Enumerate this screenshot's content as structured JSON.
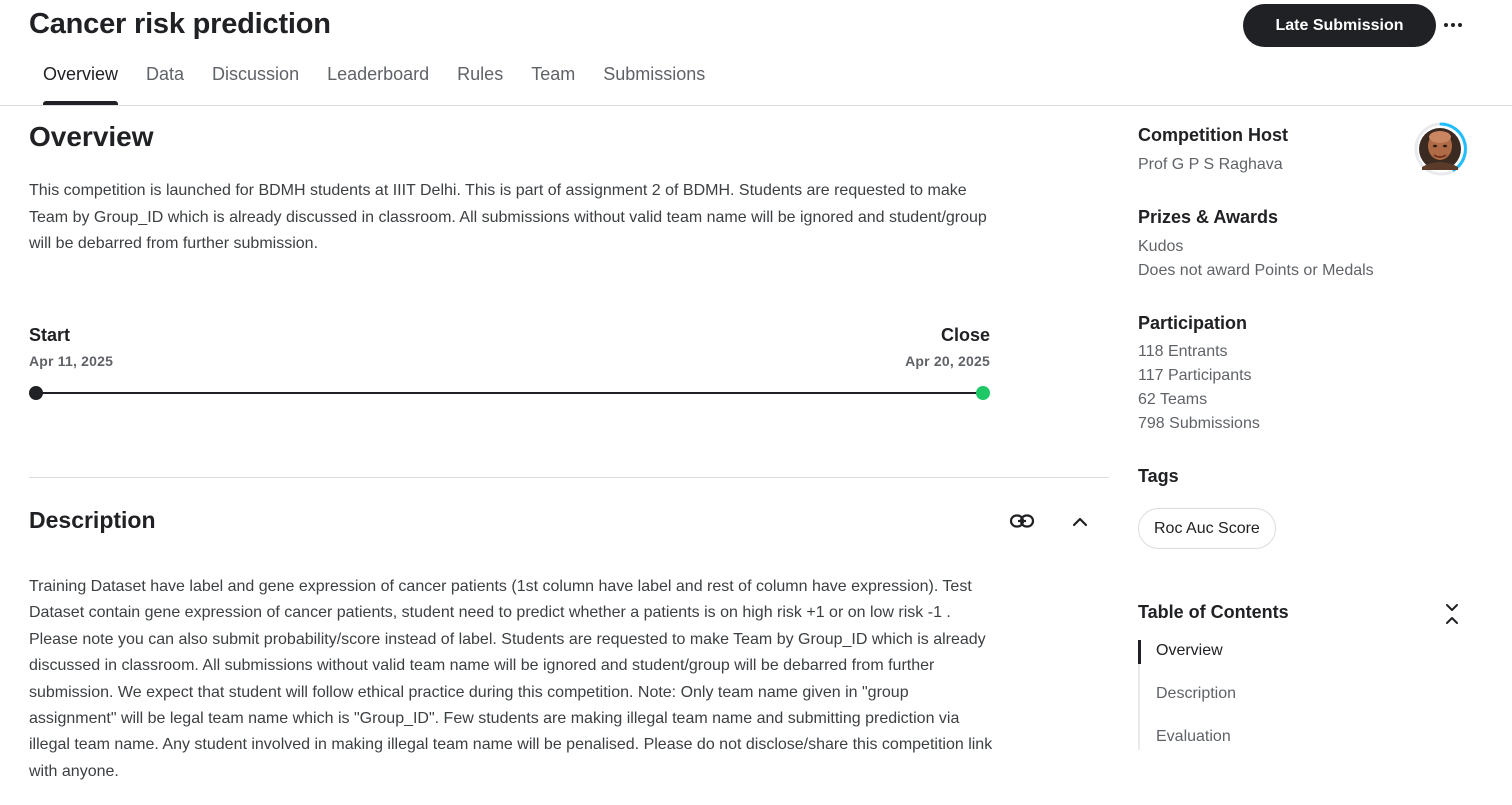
{
  "header": {
    "title": "Cancer risk prediction",
    "late_submission_label": "Late Submission",
    "more_label": "More options"
  },
  "tabs": [
    {
      "label": "Overview",
      "active": true
    },
    {
      "label": "Data"
    },
    {
      "label": "Discussion"
    },
    {
      "label": "Leaderboard"
    },
    {
      "label": "Rules"
    },
    {
      "label": "Team"
    },
    {
      "label": "Submissions"
    }
  ],
  "overview": {
    "title": "Overview",
    "text": "This competition is launched for BDMH students at IIIT Delhi. This is part of assignment 2 of BDMH. Students are requested to make Team by Group_ID which is already discussed in classroom. All submissions without valid team name will be ignored and student/group will be debarred from further submission."
  },
  "timeline": {
    "start_label": "Start",
    "start_date": "Apr 11, 2025",
    "close_label": "Close",
    "close_date": "Apr 20, 2025",
    "progress": 1.0,
    "end_color": "#1ec866"
  },
  "description": {
    "title": "Description",
    "link_icon": "link-icon",
    "collapse_icon": "chevron-up-icon",
    "text": "Training Dataset have label and gene expression of cancer patients (1st column have label and rest of column have expression). Test Dataset contain gene expression of cancer patients, student need to predict whether a patients is on high risk +1 or on low risk -1 . Please note you can also submit probability/score instead of label. Students are requested to make Team by Group_ID which is already discussed in classroom. All submissions without valid team name will be ignored and student/group will be debarred from further submission. We expect that student will follow ethical practice during this competition. Note: Only team name given in \"group assignment\" will be legal team name which is \"Group_ID\". Few students are making illegal team name and submitting prediction via illegal team name. Any student involved in making illegal team name will be penalised. Please do not disclose/share this competition link with anyone."
  },
  "sidebar": {
    "host_title": "Competition Host",
    "host_name": "Prof G P S Raghava",
    "prizes_title": "Prizes & Awards",
    "prizes": [
      "Kudos",
      "Does not award Points or Medals"
    ],
    "participation_title": "Participation",
    "participation": [
      "118 Entrants",
      "117 Participants",
      "62 Teams",
      "798 Submissions"
    ],
    "tags_title": "Tags",
    "tags": [
      "Roc Auc Score"
    ],
    "toc_title": "Table of Contents",
    "toc": [
      {
        "label": "Overview",
        "active": true
      },
      {
        "label": "Description"
      },
      {
        "label": "Evaluation"
      }
    ]
  },
  "colors": {
    "primary_text": "#202124",
    "secondary_text": "#5f6368",
    "accent_green": "#1ec866",
    "avatar_ring": "#20beff"
  }
}
